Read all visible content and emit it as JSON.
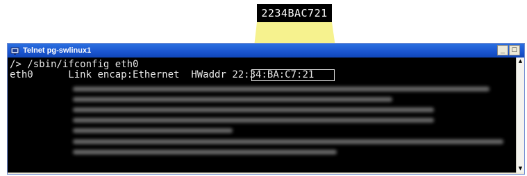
{
  "callout": {
    "mac_label": "2234BAC721",
    "highlight_color": "#f5f07a"
  },
  "window": {
    "title": "Telnet pg-swlinux1",
    "minimize_label": "_",
    "maximize_label": "□",
    "icon": "telnet-window-icon"
  },
  "terminal": {
    "line1": "/> /sbin/ifconfig eth0",
    "line2_iface": "eth0",
    "line2_encap": "Link encap:Ethernet",
    "line2_hwlabel": "HWaddr",
    "line2_mac": "22:34:BA:C7:21",
    "blurred_line_count": 8
  },
  "scrollbar": {
    "up_icon": "▲",
    "down_icon": "▼"
  }
}
